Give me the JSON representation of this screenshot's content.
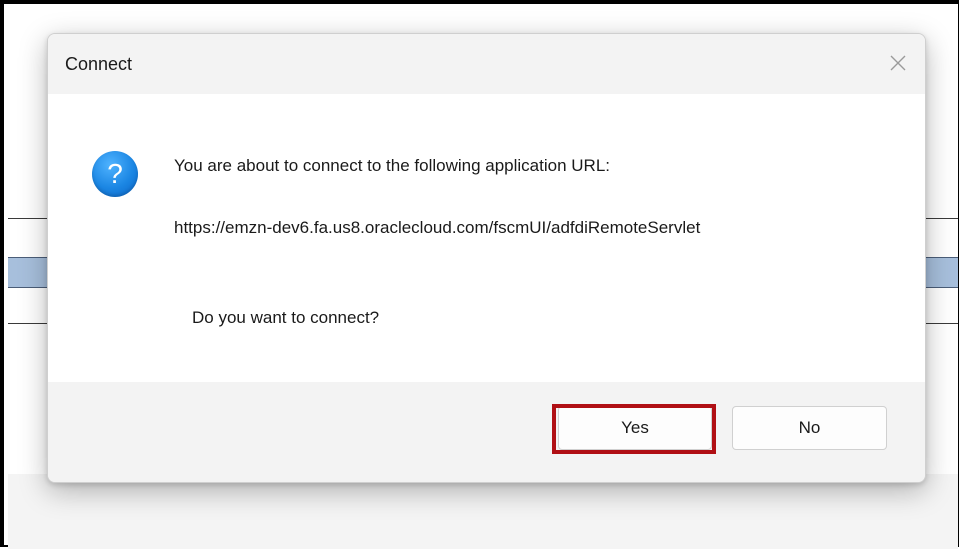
{
  "dialog": {
    "title": "Connect",
    "close_icon": "close-icon",
    "question_icon": "question-icon",
    "question_glyph": "?",
    "message": "You are about to connect to the following application URL:",
    "url": "https://emzn-dev6.fa.us8.oraclecloud.com/fscmUI/adfdiRemoteServlet",
    "prompt": "Do you want to connect?",
    "buttons": {
      "yes_label": "Yes",
      "no_label": "No"
    }
  },
  "colors": {
    "highlight": "#b00f14",
    "question_icon": "#1b86e3",
    "background_band": "#a7bfdc"
  }
}
